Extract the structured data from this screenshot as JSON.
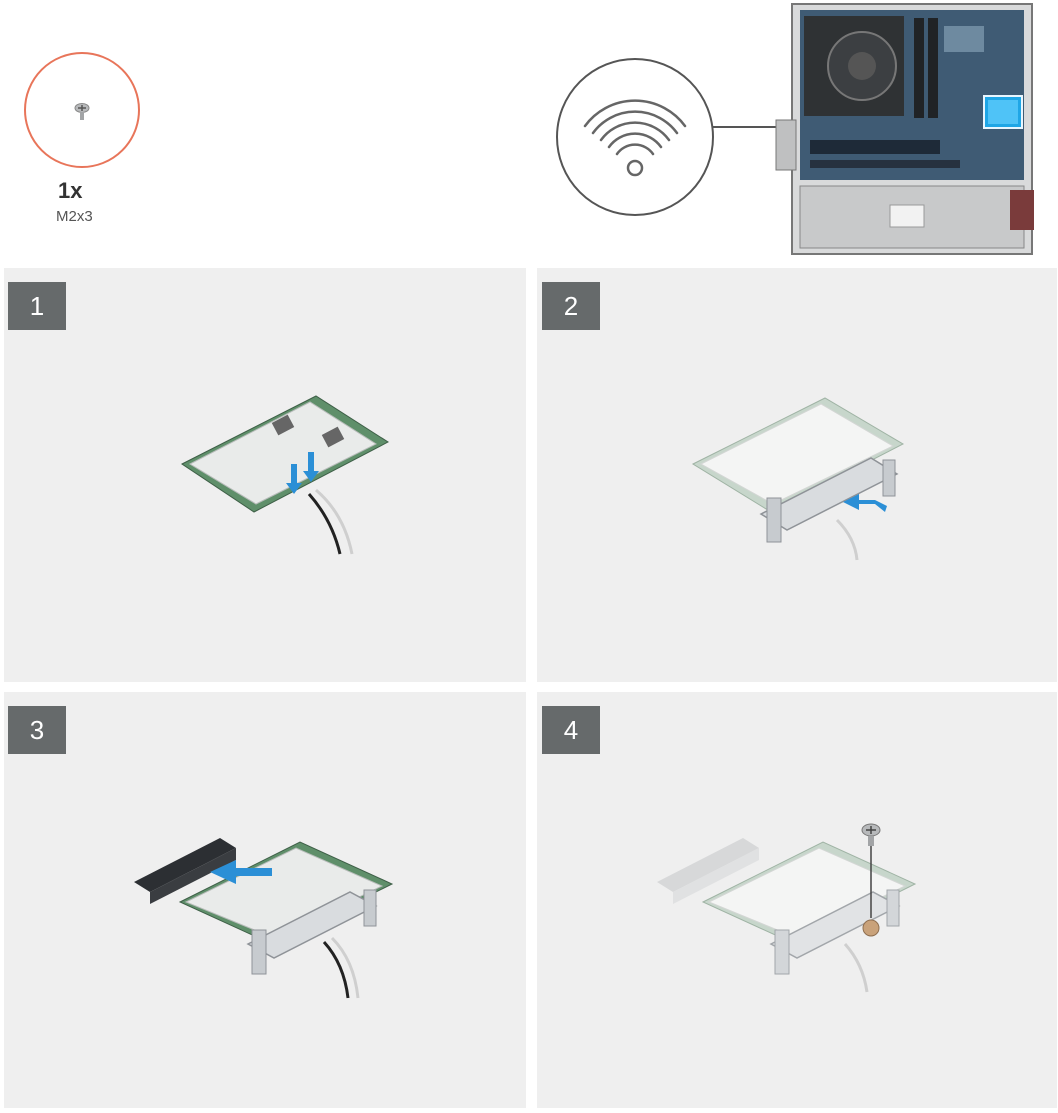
{
  "screw": {
    "count": "1x",
    "size": "M2x3"
  },
  "icons": {
    "screw": "screw-icon",
    "wifi": "wifi-icon",
    "computer": "desktop-chassis-icon",
    "arrow": "blue-arrow-icon"
  },
  "colors": {
    "screw_ring": "#e8755a",
    "panel_bg": "#efefef",
    "badge_bg": "#666a6b",
    "arrow_blue": "#2b8fd6",
    "highlight": "#1fa6e6"
  },
  "steps": [
    {
      "number": "1"
    },
    {
      "number": "2"
    },
    {
      "number": "3"
    },
    {
      "number": "4"
    }
  ]
}
